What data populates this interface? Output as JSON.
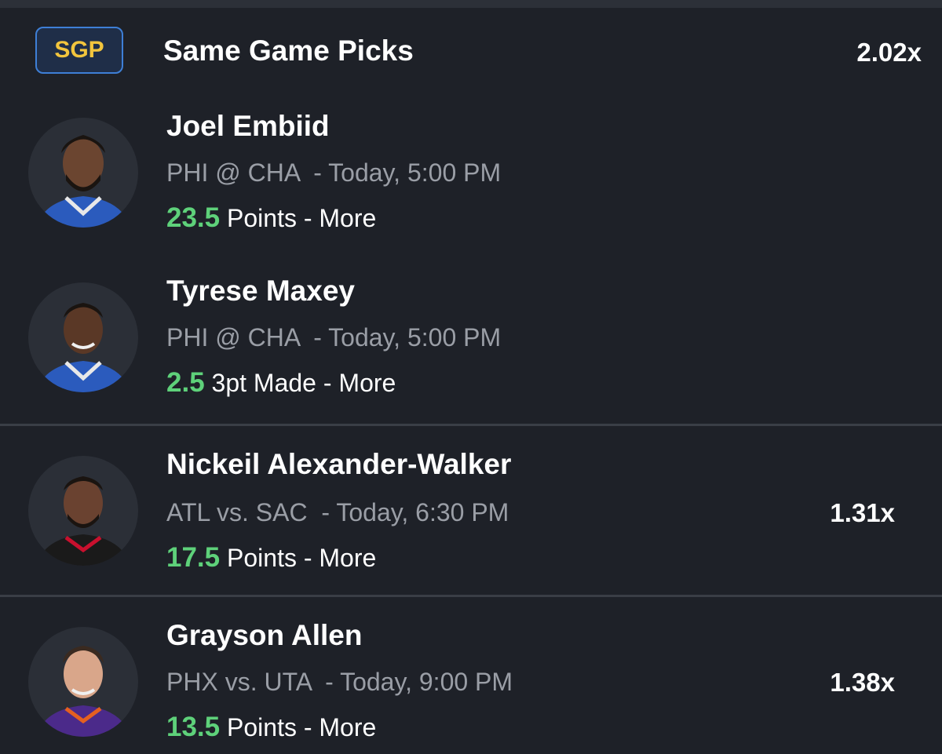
{
  "sgp": {
    "badge": "SGP",
    "title": "Same Game Picks",
    "multiplier": "2.02x"
  },
  "picks": [
    {
      "name": "Joel Embiid",
      "game": "PHI @ CHA  - Today, 5:00 PM",
      "line_value": "23.5",
      "line_stat": " Points - More",
      "multiplier": "",
      "jersey_color": "#2b5bbd"
    },
    {
      "name": "Tyrese Maxey",
      "game": "PHI @ CHA  - Today, 5:00 PM",
      "line_value": "2.5",
      "line_stat": " 3pt Made - More",
      "multiplier": "",
      "jersey_color": "#2b5bbd"
    },
    {
      "name": "Nickeil Alexander-Walker",
      "game": "ATL vs. SAC  - Today, 6:30 PM",
      "line_value": "17.5",
      "line_stat": " Points - More",
      "multiplier": "1.31x",
      "jersey_color": "#1a1a1a"
    },
    {
      "name": "Grayson Allen",
      "game": "PHX vs. UTA  - Today, 9:00 PM",
      "line_value": "13.5",
      "line_stat": " Points - More",
      "multiplier": "1.38x",
      "jersey_color": "#4b2a8a"
    }
  ]
}
